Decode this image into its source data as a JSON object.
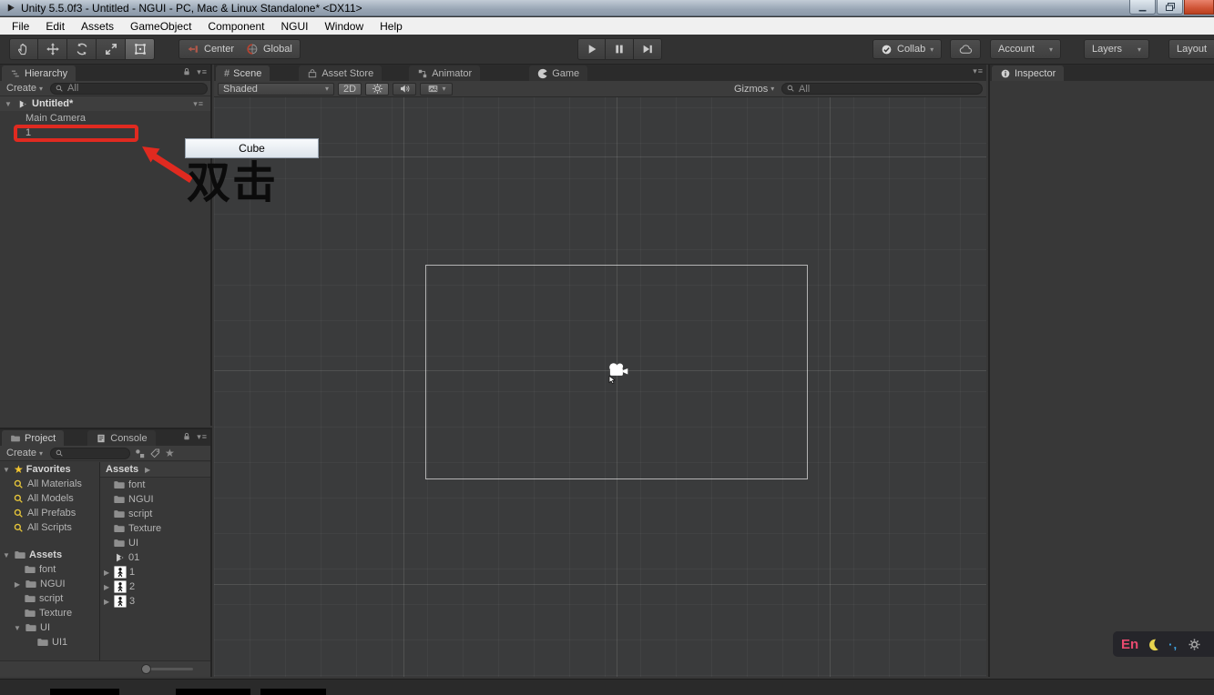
{
  "window": {
    "title": "Unity 5.5.0f3 - Untitled - NGUI - PC, Mac & Linux Standalone* <DX11>"
  },
  "menu": {
    "items": [
      {
        "label": "File"
      },
      {
        "label": "Edit"
      },
      {
        "label": "Assets"
      },
      {
        "label": "GameObject"
      },
      {
        "label": "Component"
      },
      {
        "label": "NGUI"
      },
      {
        "label": "Window"
      },
      {
        "label": "Help"
      }
    ]
  },
  "toolbar": {
    "pivot_label": "Center",
    "space_label": "Global",
    "collab_label": "Collab",
    "account_label": "Account",
    "layers_label": "Layers",
    "layout_label": "Layout"
  },
  "hierarchy": {
    "tab_label": "Hierarchy",
    "create_label": "Create",
    "search_placeholder": "All",
    "scene_row": "Untitled*",
    "rows": [
      {
        "label": "Main Camera"
      },
      {
        "label": "1"
      }
    ]
  },
  "scene": {
    "tabs": [
      {
        "label": "Scene"
      },
      {
        "label": "Asset Store"
      },
      {
        "label": "Animator"
      },
      {
        "label": "Game"
      }
    ],
    "shading_mode": "Shaded",
    "mode_2d": "2D",
    "gizmos_label": "Gizmos",
    "search_placeholder": "All"
  },
  "inspector": {
    "tab_label": "Inspector"
  },
  "project": {
    "tab_project": "Project",
    "tab_console": "Console",
    "create_label": "Create",
    "favorites_label": "Favorites",
    "favorites": [
      {
        "label": "All Materials"
      },
      {
        "label": "All Models"
      },
      {
        "label": "All Prefabs"
      },
      {
        "label": "All Scripts"
      }
    ],
    "tree_root": "Assets",
    "tree": [
      {
        "label": "font"
      },
      {
        "label": "NGUI"
      },
      {
        "label": "script"
      },
      {
        "label": "Texture"
      },
      {
        "label": "UI"
      },
      {
        "label": "UI1"
      }
    ],
    "breadcrumb": "Assets",
    "list": [
      {
        "label": "font"
      },
      {
        "label": "NGUI"
      },
      {
        "label": "script"
      },
      {
        "label": "Texture"
      },
      {
        "label": "UI"
      },
      {
        "label": "01"
      },
      {
        "label": "1"
      },
      {
        "label": "2"
      },
      {
        "label": "3"
      }
    ]
  },
  "annotations": {
    "tooltip": "Cube",
    "note": "双击"
  },
  "ime": {
    "lang": "En",
    "punct": "·,"
  },
  "colors": {
    "accent_red": "#e02a20",
    "panel": "#383838",
    "selection_blue": "#3e5f96"
  }
}
